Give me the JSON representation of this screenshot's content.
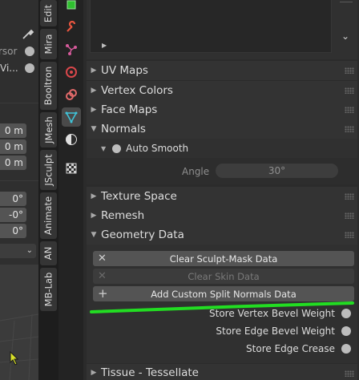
{
  "left_panel": {
    "option1": "rsor",
    "option2": "Vi...",
    "transform_fields": [
      "0 m",
      "0 m",
      "0 m"
    ],
    "rotation_fields": [
      "0°",
      "-0°",
      "0°"
    ]
  },
  "vertical_tabs": [
    "Edit",
    "Mira",
    "Booltron",
    "JMesh",
    "JSculpt",
    "Animate",
    "AN",
    "MB-Lab"
  ],
  "property_icons": [
    "tool-icon",
    "wrench-icon",
    "particles-icon",
    "physics-icon",
    "constraints-icon",
    "mesh-data-icon",
    "material-icon",
    "texture-icon"
  ],
  "sections": {
    "uv_maps": "UV Maps",
    "vertex_colors": "Vertex Colors",
    "face_maps": "Face Maps",
    "normals": "Normals",
    "auto_smooth": "Auto Smooth",
    "angle_label": "Angle",
    "angle_value": "30°",
    "texture_space": "Texture Space",
    "remesh": "Remesh",
    "geometry_data": "Geometry Data",
    "tissue": "Tissue - Tessellate"
  },
  "geometry_data": {
    "clear_sculpt_mask": "Clear Sculpt-Mask Data",
    "clear_skin": "Clear Skin Data",
    "add_split_normals": "Add Custom Split Normals Data",
    "store_vertex_bevel": "Store Vertex Bevel Weight",
    "store_edge_bevel": "Store Edge Bevel Weight",
    "store_edge_crease": "Store Edge Crease"
  },
  "colors": {
    "highlight_underline": "#22dd22",
    "active_icon": "#4a4a4a"
  }
}
